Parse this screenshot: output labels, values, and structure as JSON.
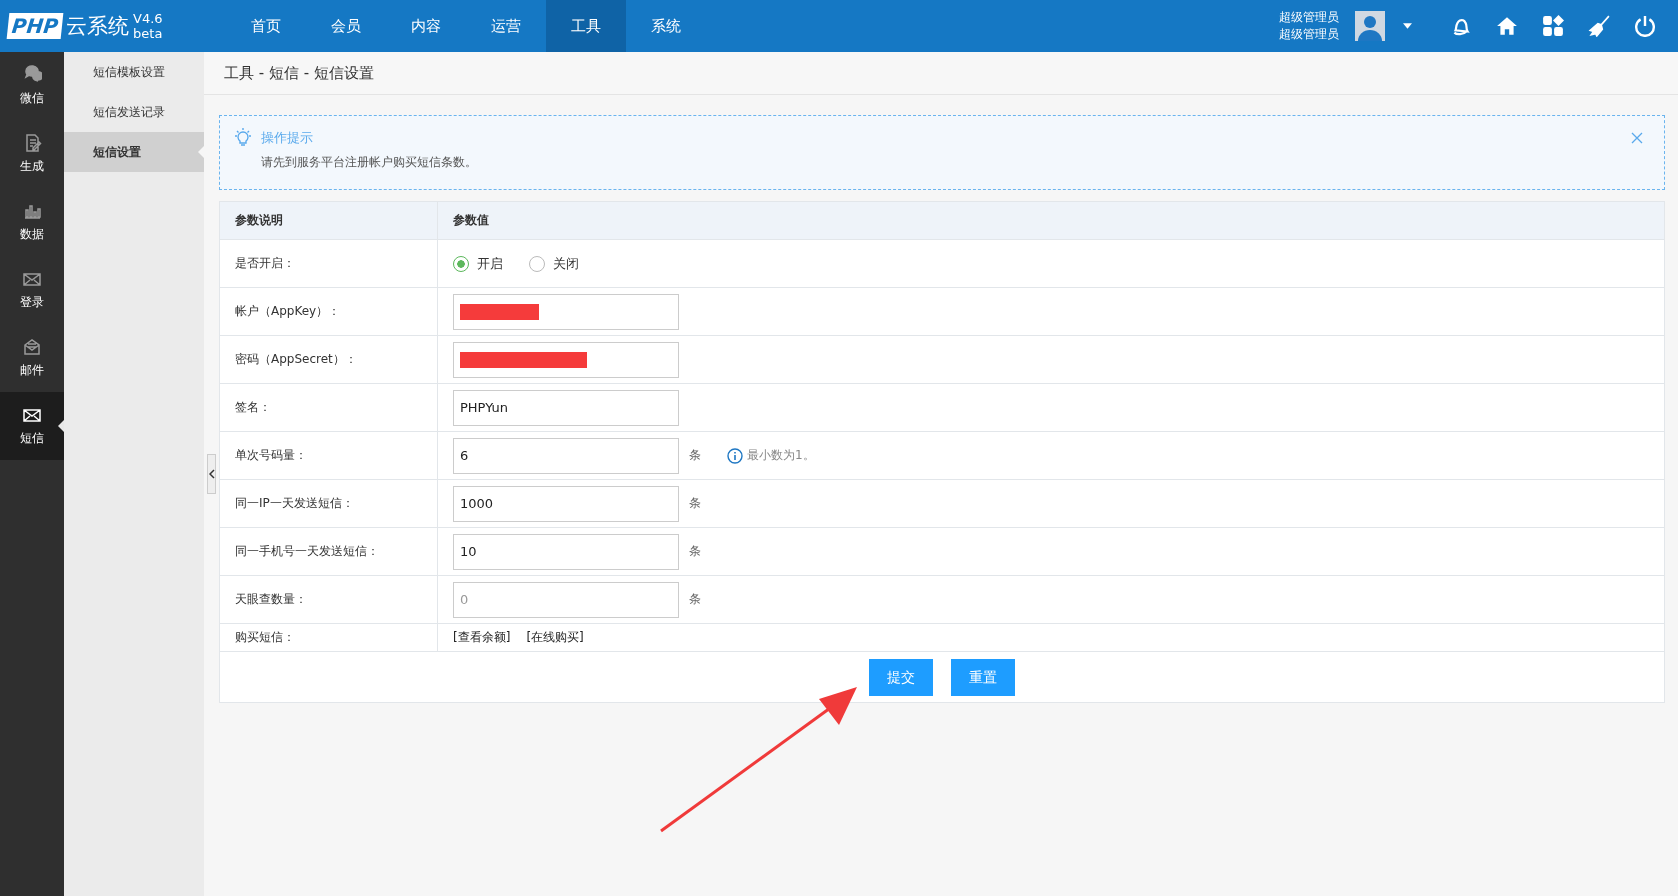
{
  "logo": {
    "mark": "PHP",
    "title": "云系统",
    "version": "V4.6",
    "edition": "beta"
  },
  "top_nav": [
    {
      "label": "首页",
      "selected": false
    },
    {
      "label": "会员",
      "selected": false
    },
    {
      "label": "内容",
      "selected": false
    },
    {
      "label": "运营",
      "selected": false
    },
    {
      "label": "工具",
      "selected": true
    },
    {
      "label": "系统",
      "selected": false
    }
  ],
  "user": {
    "name": "超级管理员",
    "role": "超级管理员"
  },
  "side_rail": [
    {
      "kind": "wechat",
      "label": "微信",
      "selected": false
    },
    {
      "kind": "generate",
      "label": "生成",
      "selected": false
    },
    {
      "kind": "data",
      "label": "数据",
      "selected": false
    },
    {
      "kind": "login",
      "label": "登录",
      "selected": false
    },
    {
      "kind": "mail",
      "label": "邮件",
      "selected": false
    },
    {
      "kind": "sms",
      "label": "短信",
      "selected": true
    }
  ],
  "sub_nav": [
    {
      "label": "短信模板设置",
      "selected": false
    },
    {
      "label": "短信发送记录",
      "selected": false
    },
    {
      "label": "短信设置",
      "selected": true
    }
  ],
  "breadcrumb": "工具 - 短信 - 短信设置",
  "tip": {
    "title": "操作提示",
    "items": [
      "请先到服务平台注册帐户购买短信条数。"
    ]
  },
  "table": {
    "columns": [
      "参数说明",
      "参数值"
    ],
    "rows": [
      {
        "kind": "radio",
        "label": "是否开启：",
        "options": [
          {
            "label": "开启",
            "selected": true
          },
          {
            "label": "关闭",
            "selected": false
          }
        ]
      },
      {
        "kind": "redacted",
        "label": "帐户（AppKey）："
      },
      {
        "kind": "redacted",
        "label": "密码（AppSecret）："
      },
      {
        "kind": "text",
        "label": "签名：",
        "value": "PHPYun"
      },
      {
        "kind": "text",
        "label": "单次号码量：",
        "value": "6",
        "unit": "条",
        "hint": "最小数为1。"
      },
      {
        "kind": "text",
        "label": "同一IP一天发送短信：",
        "value": "1000",
        "unit": "条"
      },
      {
        "kind": "text",
        "label": "同一手机号一天发送短信：",
        "value": "10",
        "unit": "条"
      },
      {
        "kind": "text",
        "label": "天眼查数量：",
        "placeholder": "0",
        "unit": "条"
      },
      {
        "kind": "links",
        "label": "购买短信：",
        "links": [
          "[查看余额]",
          "[在线购买]"
        ]
      }
    ]
  },
  "buttons": [
    "提交",
    "重置"
  ]
}
